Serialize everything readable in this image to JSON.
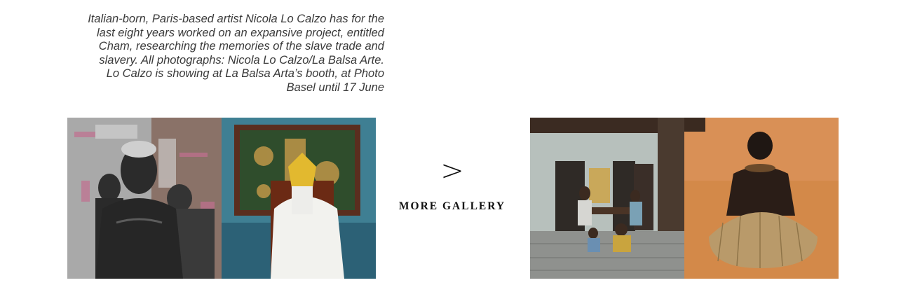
{
  "caption": {
    "line1": "Italian-born, Paris-based artist Nicola Lo Calzo has for the",
    "line2": "last eight years worked on an expansive project, entitled",
    "line3": "Cham, researching the memories of the slave trade and",
    "line4": "slavery. All photographs: Nicola Lo Calzo/La Balsa Arte.",
    "line5": "Lo Calzo is showing at La Balsa Arta’s booth, at Photo",
    "line6": "Basel until 17 June"
  },
  "gallery_nav": {
    "arrow_glyph": ">",
    "label": "MORE GALLERY"
  },
  "photos": [
    {
      "name": "photo-painted-men",
      "dominant_color": "#6b6b6b"
    },
    {
      "name": "photo-masked-figure-throne",
      "dominant_color": "#3d7c91"
    },
    {
      "name": "photo-colonial-interior",
      "dominant_color": "#9aa39a"
    },
    {
      "name": "photo-back-grass-skirt",
      "dominant_color": "#d1854a"
    }
  ]
}
